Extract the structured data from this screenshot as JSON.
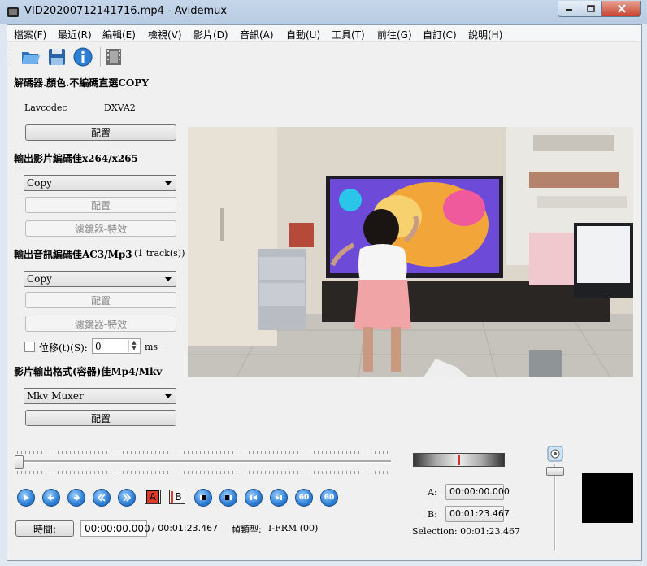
{
  "window": {
    "title": "VID20200712141716.mp4 - Avidemux"
  },
  "menu": [
    "檔案(F)",
    "最近(R)",
    "編輯(E)",
    "檢視(V)",
    "影片(D)",
    "音訊(A)",
    "自動(U)",
    "工具(T)",
    "前往(G)",
    "自訂(C)",
    "說明(H)"
  ],
  "decoder": {
    "heading": "解碼器.顏色.不編碼直選COPY",
    "lib": "Lavcodec",
    "hw": "DXVA2",
    "config_label": "配置"
  },
  "video_out": {
    "heading": "輸出影片編碼佳x264/x265",
    "codec": "Copy",
    "config_label": "配置",
    "filters_label": "濾鏡器-特效"
  },
  "audio_out": {
    "heading": "輸出音訊編碼佳AC3/Mp3",
    "tracks": "(1 track(s))",
    "codec": "Copy",
    "config_label": "配置",
    "filters_label": "濾鏡器-特效",
    "shift_label": "位移(t)(S):",
    "shift_value": "0",
    "shift_unit": "ms"
  },
  "muxer": {
    "heading": "影片輸出格式(容器)佳Mp4/Mkv",
    "format": "Mkv Muxer",
    "config_label": "配置"
  },
  "markers": {
    "a_label": "A:",
    "a_value": "00:00:00.000",
    "b_label": "B:",
    "b_value": "00:01:23.467",
    "selection": "Selection: 00:01:23.467"
  },
  "status": {
    "time_button": "時間:",
    "current_time": "00:00:00.000",
    "duration": "/ 00:01:23.467",
    "frame_type_label": "幀類型:",
    "frame_type": "I-FRM (00)"
  },
  "ab_buttons": {
    "a": "A",
    "b": "B"
  },
  "nav_icons": [
    "play-icon",
    "prev-frame-icon",
    "next-frame-icon",
    "prev-keyframe-icon",
    "next-keyframe-icon",
    "set-marker-a-icon",
    "set-marker-b-icon",
    "prev-black-icon",
    "next-black-icon",
    "goto-first-icon",
    "goto-last-icon",
    "back-60-icon",
    "forward-60-icon"
  ],
  "nav_labels": {
    "back60": "60",
    "fwd60": "60"
  },
  "colors": {
    "accent": "#2d7fd6",
    "marker_red": "#d83030"
  }
}
